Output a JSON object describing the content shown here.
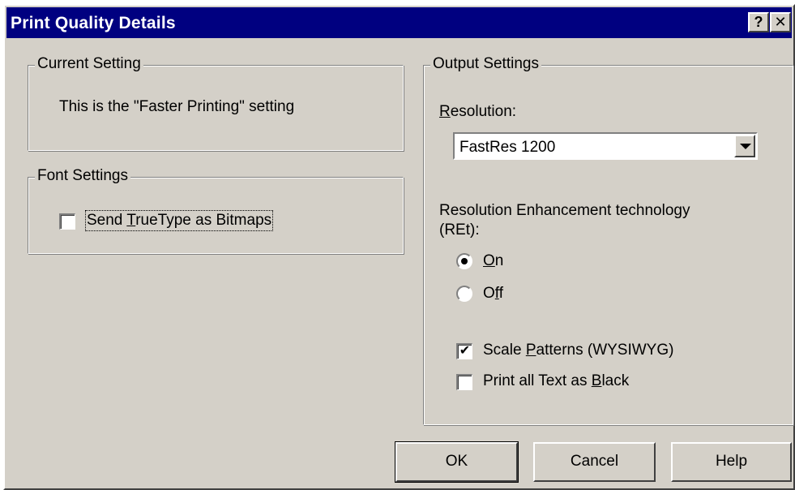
{
  "window": {
    "title": "Print Quality Details",
    "help_button": "?",
    "close_button": "✕"
  },
  "current_setting": {
    "legend": "Current Setting",
    "text": "This is the \"Faster Printing\" setting"
  },
  "font_settings": {
    "legend": "Font Settings",
    "send_truetype": {
      "label_before": "Send ",
      "label_accel": "T",
      "label_after": "rueType as Bitmaps",
      "checked": false
    }
  },
  "output_settings": {
    "legend": "Output Settings",
    "resolution_label_accel": "R",
    "resolution_label_rest": "esolution:",
    "resolution_value": "FastRes 1200",
    "ret_label_line1": "Resolution Enhancement technology",
    "ret_label_line2": "(REt):",
    "ret_on": {
      "label_accel": "O",
      "label_rest": "n",
      "selected": true
    },
    "ret_off": {
      "label_before": "O",
      "label_accel": "f",
      "label_after": "f",
      "selected": false
    },
    "scale_patterns": {
      "label_before": "Scale ",
      "label_accel": "P",
      "label_after": "atterns (WYSIWYG)",
      "checked": true,
      "check_mark": "✔"
    },
    "print_black": {
      "label_before": "Print all Text as ",
      "label_accel": "B",
      "label_after": "lack",
      "checked": false
    }
  },
  "buttons": {
    "ok": "OK",
    "cancel": "Cancel",
    "help": "Help"
  },
  "colors": {
    "face": "#d4d0c8",
    "titlebar": "#000080",
    "field": "#ffffff"
  }
}
